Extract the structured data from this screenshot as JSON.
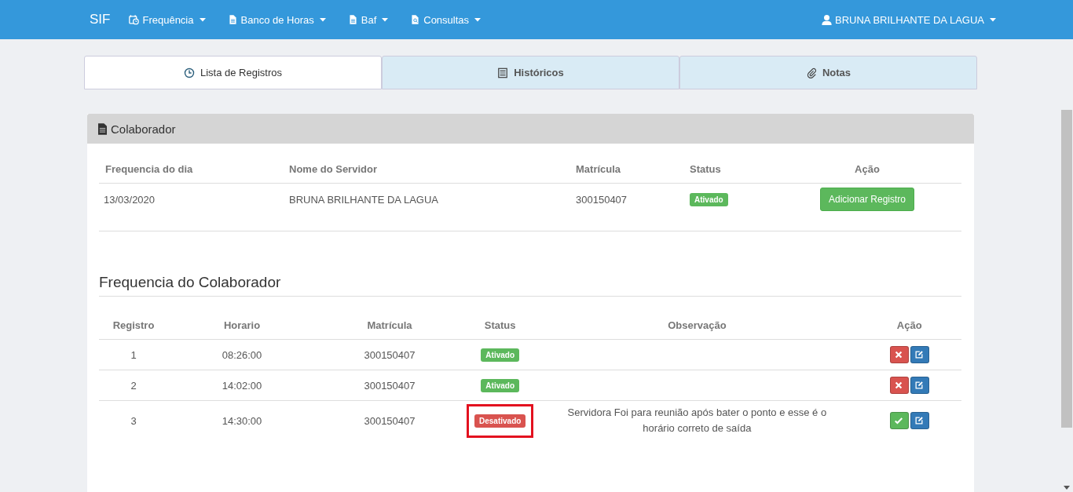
{
  "navbar": {
    "brand": "SIF",
    "menus": [
      {
        "label": "Frequência"
      },
      {
        "label": "Banco de Horas"
      },
      {
        "label": "Baf"
      },
      {
        "label": "Consultas"
      }
    ],
    "user": "BRUNA BRILHANTE DA LAGUA"
  },
  "tabs": [
    {
      "label": "Lista de Registros",
      "selected": true
    },
    {
      "label": "Históricos",
      "selected": false
    },
    {
      "label": "Notas",
      "selected": false
    }
  ],
  "panel": {
    "title": "Colaborador",
    "table": {
      "columns": [
        "Frequencia do dia",
        "Nome do Servidor",
        "Matrícula",
        "Status",
        "Ação"
      ],
      "rows": [
        {
          "date": "13/03/2020",
          "name": "BRUNA BRILHANTE DA LAGUA",
          "matricula": "300150407",
          "status": {
            "label": "Ativado",
            "kind": "active"
          },
          "action": "Adicionar Registro"
        }
      ]
    },
    "section_title": "Frequencia do Colaborador",
    "records": {
      "columns": [
        "Registro",
        "Horario",
        "Matrícula",
        "Status",
        "Observação",
        "Ação"
      ],
      "rows": [
        {
          "registro": "1",
          "horario": "08:26:00",
          "matricula": "300150407",
          "status": {
            "label": "Ativado",
            "kind": "active"
          },
          "highlighted": false,
          "actions": [
            {
              "kind": "delete"
            },
            {
              "kind": "edit"
            }
          ]
        },
        {
          "registro": "2",
          "horario": "14:02:00",
          "matricula": "300150407",
          "status": {
            "label": "Ativado",
            "kind": "active"
          },
          "highlighted": false,
          "actions": [
            {
              "kind": "delete"
            },
            {
              "kind": "edit"
            }
          ]
        },
        {
          "registro": "3",
          "horario": "14:30:00",
          "matricula": "300150407",
          "status": {
            "label": "Desativado",
            "kind": "inactive"
          },
          "highlighted": true,
          "observacao": "Servidora Foi para reunião após bater o ponto e esse é o horário correto de saída",
          "actions": [
            {
              "kind": "approve"
            },
            {
              "kind": "edit"
            }
          ]
        }
      ]
    }
  }
}
